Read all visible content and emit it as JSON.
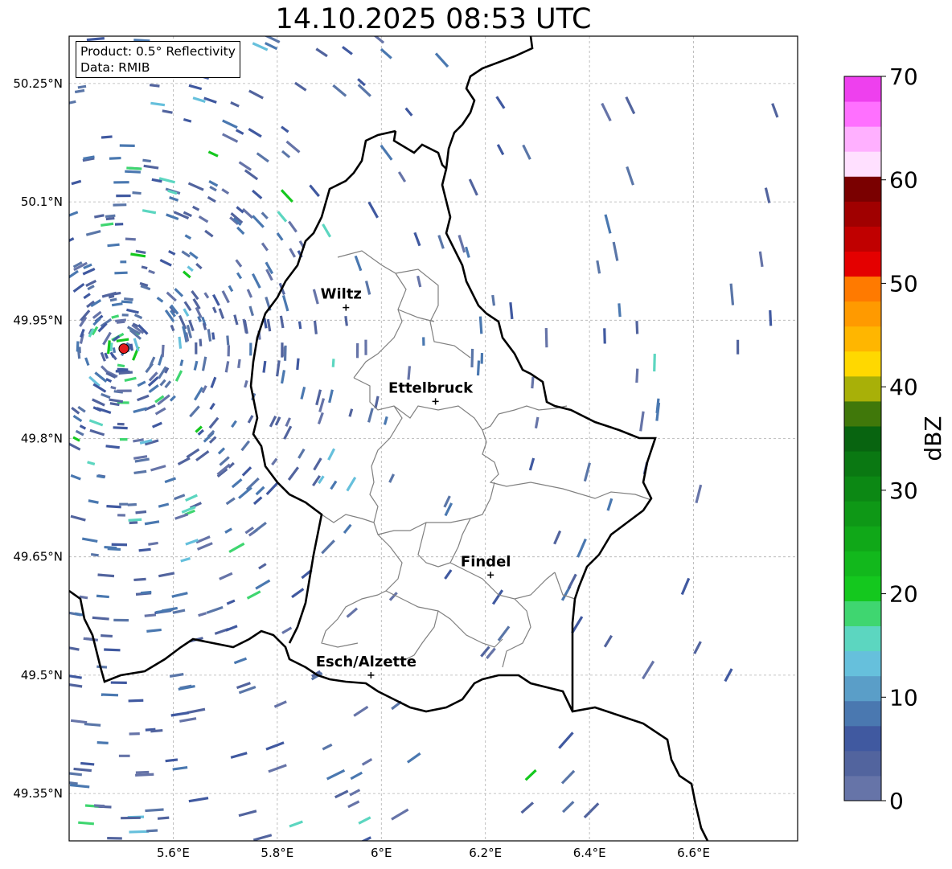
{
  "title": "14.10.2025 08:53 UTC",
  "info": {
    "product": "Product: 0.5° Reflectivity",
    "data": "Data: RMIB"
  },
  "map": {
    "lon_range": [
      5.4,
      6.8
    ],
    "lat_range": [
      49.29,
      50.31
    ],
    "lat_ticks": [
      {
        "value": 50.25,
        "label": "50.25°N"
      },
      {
        "value": 50.1,
        "label": "50.1°N"
      },
      {
        "value": 49.95,
        "label": "49.95°N"
      },
      {
        "value": 49.8,
        "label": "49.8°N"
      },
      {
        "value": 49.65,
        "label": "49.65°N"
      },
      {
        "value": 49.5,
        "label": "49.5°N"
      },
      {
        "value": 49.35,
        "label": "49.35°N"
      }
    ],
    "lon_ticks": [
      {
        "value": 5.6,
        "label": "5.6°E"
      },
      {
        "value": 5.8,
        "label": "5.8°E"
      },
      {
        "value": 6.0,
        "label": "6°E"
      },
      {
        "value": 6.2,
        "label": "6.2°E"
      },
      {
        "value": 6.4,
        "label": "6.4°E"
      },
      {
        "value": 6.6,
        "label": "6.6°E"
      }
    ],
    "grid": true,
    "radar_site": {
      "lon": 5.505,
      "lat": 49.914,
      "color": "#e31a1c"
    },
    "cities": [
      {
        "name": "Wiltz",
        "lon": 5.932,
        "lat": 49.966
      },
      {
        "name": "Ettelbruck",
        "lon": 6.104,
        "lat": 49.847
      },
      {
        "name": "Findel",
        "lon": 6.21,
        "lat": 49.627
      },
      {
        "name": "Esch/Alzette",
        "lon": 5.98,
        "lat": 49.5
      }
    ]
  },
  "colorbar": {
    "label": "dBZ",
    "min": 0,
    "max": 70,
    "ticks": [
      0,
      10,
      20,
      30,
      40,
      50,
      60,
      70
    ],
    "colors": [
      "#6674a8",
      "#52649e",
      "#4059a0",
      "#4a78b0",
      "#5a9ec8",
      "#66c0dc",
      "#5cd6c0",
      "#3fd670",
      "#14c81e",
      "#12b81c",
      "#10a818",
      "#0e9816",
      "#0c8814",
      "#0a7812",
      "#086410",
      "#40780a",
      "#a8b008",
      "#ffd800",
      "#ffb600",
      "#ff9a00",
      "#ff7a00",
      "#e40000",
      "#c00000",
      "#a00000",
      "#7a0000",
      "#ffe0ff",
      "#ffb0ff",
      "#ff70ff",
      "#ee40ee"
    ]
  }
}
